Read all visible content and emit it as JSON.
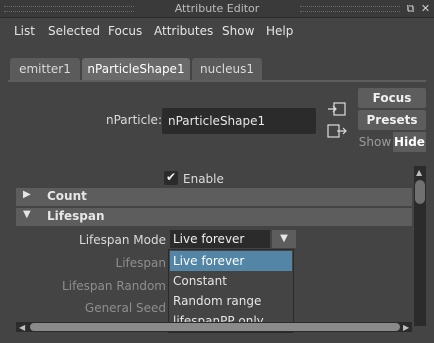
{
  "window": {
    "title": "Attribute Editor"
  },
  "menu": {
    "items": [
      "List",
      "Selected",
      "Focus",
      "Attributes",
      "Show",
      "Help"
    ]
  },
  "tabs": [
    "emitter1",
    "nParticleShape1",
    "nucleus1"
  ],
  "node": {
    "label": "nParticle:",
    "value": "nParticleShape1"
  },
  "buttons": {
    "focus": "Focus",
    "presets": "Presets",
    "show": "Show",
    "hide": "Hide"
  },
  "enable": {
    "label": "Enable",
    "check": "✔"
  },
  "sections": [
    {
      "label": "Count",
      "arrow": "▶"
    },
    {
      "label": "Lifespan",
      "arrow": "▼"
    }
  ],
  "attributes": {
    "mode_label": "Lifespan Mode",
    "mode_value": "Live forever",
    "lifespan_label": "Lifespan",
    "lifespan_random_label": "Lifespan Random",
    "general_seed_label": "General Seed"
  },
  "dropdown": {
    "options": [
      "Live forever",
      "Constant",
      "Random range",
      "lifespanPP only"
    ],
    "selected": "Live forever"
  },
  "colors": {
    "background": "#444444",
    "field": "#2b2b2b",
    "button": "#5d5d5d",
    "selection": "#5285a6"
  }
}
